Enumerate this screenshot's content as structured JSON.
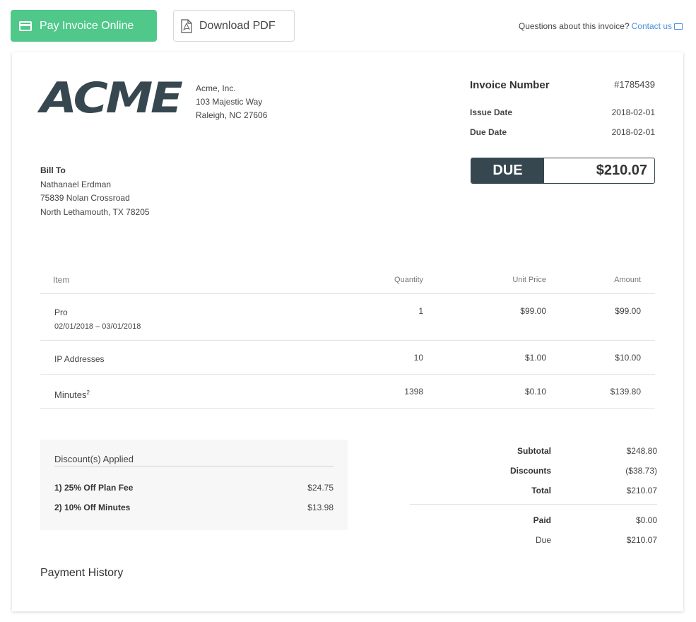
{
  "toolbar": {
    "pay_label": "Pay Invoice Online",
    "pdf_label": "Download PDF",
    "questions_text": "Questions about this invoice?",
    "contact_label": "Contact us"
  },
  "company": {
    "logo_text": "ACME",
    "name": "Acme, Inc.",
    "street": "103 Majestic Way",
    "city": "Raleigh, NC 27606"
  },
  "invoice": {
    "number_label": "Invoice Number",
    "number": "#1785439",
    "issue_label": "Issue Date",
    "issue_date": "2018-02-01",
    "due_label": "Due Date",
    "due_date": "2018-02-01",
    "due_box_label": "DUE",
    "due_amount": "$210.07"
  },
  "bill_to": {
    "title": "Bill To",
    "name": "Nathanael Erdman",
    "street": "75839 Nolan Crossroad",
    "city": "North Lethamouth, TX 78205"
  },
  "items": {
    "headers": {
      "item": "Item",
      "quantity": "Quantity",
      "unit_price": "Unit Price",
      "amount": "Amount"
    },
    "rows": [
      {
        "name": "Pro",
        "period": "02/01/2018 – 03/01/2018",
        "quantity": "1",
        "unit_price": "$99.00",
        "amount": "$99.00"
      },
      {
        "name": "IP Addresses",
        "quantity": "10",
        "unit_price": "$1.00",
        "amount": "$10.00"
      },
      {
        "name": "Minutes",
        "sup": "2",
        "quantity": "1398",
        "unit_price": "$0.10",
        "amount": "$139.80"
      }
    ]
  },
  "discounts": {
    "title": "Discount(s) Applied",
    "rows": [
      {
        "label": "1) 25% Off Plan Fee",
        "amount": "$24.75"
      },
      {
        "label": "2) 10% Off Minutes",
        "amount": "$13.98"
      }
    ]
  },
  "totals": {
    "subtotal_label": "Subtotal",
    "subtotal": "$248.80",
    "discounts_label": "Discounts",
    "discounts": "($38.73)",
    "total_label": "Total",
    "total": "$210.07",
    "paid_label": "Paid",
    "paid": "$0.00",
    "due_label": "Due",
    "due": "$210.07"
  },
  "payment_history_title": "Payment History",
  "colors": {
    "pay_button": "#4fc88a",
    "logo": "#37474f",
    "link": "#4a90d9"
  }
}
